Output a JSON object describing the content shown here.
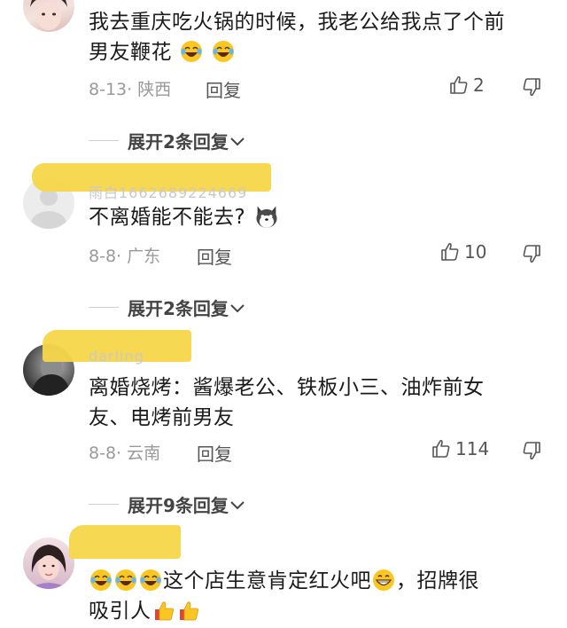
{
  "comments": [
    {
      "text_line1": "我去重庆吃火锅的时候，我老公给我点了个前",
      "text_line2": "男友鞭花",
      "emoji": "laughing-crying-face",
      "date": "8-13",
      "sep": "·",
      "location": "陕西",
      "reply_label": "回复",
      "likes": "2",
      "expand_label": "展开2条回复"
    },
    {
      "username_faint": "雨白1662689224669",
      "text_line1": "不离婚能不能去?",
      "emoji": "husky-dog-face",
      "date": "8-8",
      "sep": "·",
      "location": "广东",
      "reply_label": "回复",
      "likes": "10",
      "expand_label": "展开2条回复"
    },
    {
      "username_faint": "darling",
      "text_line1": "离婚烧烤：酱爆老公、铁板小三、油炸前女",
      "text_line2": "友、电烤前男友",
      "date": "8-8",
      "sep": "·",
      "location": "云南",
      "reply_label": "回复",
      "likes": "114",
      "expand_label": "展开9条回复"
    },
    {
      "text_line1_suffix": "这个店生意肯定红火吧",
      "text_line1_tail": "，招牌很",
      "text_line2": "吸引人",
      "emoji": "laughing-crying-face"
    }
  ],
  "colors": {
    "highlight": "#f7d64a",
    "meta": "#9a9a9a",
    "text": "#1b1b1b"
  },
  "icons": {
    "like": "thumbs-up-outline-icon",
    "dislike": "thumbs-down-outline-icon",
    "expand": "chevron-down-icon"
  }
}
